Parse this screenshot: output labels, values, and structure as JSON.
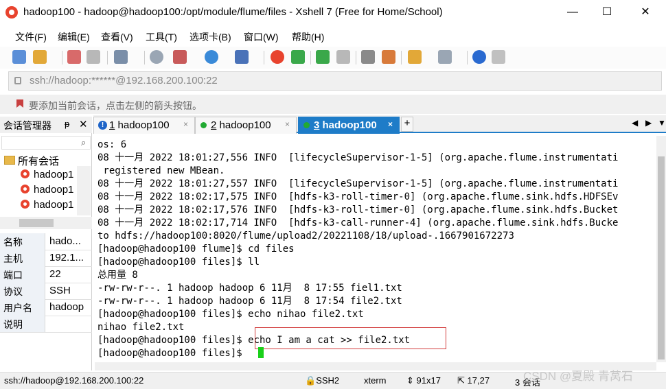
{
  "window": {
    "title": "hadoop100 - hadoop@hadoop100:/opt/module/flume/files - Xshell 7 (Free for Home/School)",
    "controls": {
      "minimize": "—",
      "maximize": "☐",
      "close": "✕"
    }
  },
  "menu": [
    "文件(F)",
    "编辑(E)",
    "查看(V)",
    "工具(T)",
    "选项卡(B)",
    "窗口(W)",
    "帮助(H)"
  ],
  "address": {
    "value": "ssh://hadoop:******@192.168.200.100:22"
  },
  "hint": {
    "text": "要添加当前会话，点击左侧的箭头按钮。"
  },
  "sidebar": {
    "title": "会话管理器",
    "pin": "ᵽ",
    "close": "✕",
    "search_icon": "⌕",
    "tree_root": "所有会话",
    "sessions": [
      "hadoop1",
      "hadoop1",
      "hadoop1"
    ],
    "properties": [
      {
        "key": "名称",
        "value": "hado..."
      },
      {
        "key": "主机",
        "value": "192.1..."
      },
      {
        "key": "端口",
        "value": "22"
      },
      {
        "key": "协议",
        "value": "SSH"
      },
      {
        "key": "用户名",
        "value": "hadoop"
      },
      {
        "key": "说明",
        "value": ""
      }
    ]
  },
  "tabs": [
    {
      "num": "1",
      "label": "hadoop100",
      "status": "warning"
    },
    {
      "num": "2",
      "label": "hadoop100",
      "status": "connected"
    },
    {
      "num": "3",
      "label": "hadoop100",
      "status": "connected"
    }
  ],
  "tab_close": "×",
  "tab_add": "+",
  "terminal": {
    "lines": [
      "os: 6",
      "08 十一月 2022 18:01:27,556 INFO  [lifecycleSupervisor-1-5] (org.apache.flume.instrumentati",
      " registered new MBean.",
      "08 十一月 2022 18:01:27,557 INFO  [lifecycleSupervisor-1-5] (org.apache.flume.instrumentati",
      "08 十一月 2022 18:02:17,575 INFO  [hdfs-k3-roll-timer-0] (org.apache.flume.sink.hdfs.HDFSEv",
      "08 十一月 2022 18:02:17,576 INFO  [hdfs-k3-roll-timer-0] (org.apache.flume.sink.hdfs.Bucket",
      "08 十一月 2022 18:02:17,714 INFO  [hdfs-k3-call-runner-4] (org.apache.flume.sink.hdfs.Bucke",
      "to hdfs://hadoop100:8020/flume/upload2/20221108/18/upload-.1667901672273",
      "[hadoop@hadoop100 flume]$ cd files",
      "[hadoop@hadoop100 files]$ ll",
      "总用量 8",
      "-rw-rw-r--. 1 hadoop hadoop 6 11月  8 17:55 fiel1.txt",
      "-rw-rw-r--. 1 hadoop hadoop 6 11月  8 17:54 file2.txt",
      "[hadoop@hadoop100 files]$ echo nihao file2.txt",
      "nihao file2.txt",
      "[hadoop@hadoop100 files]$ echo I am a cat >> file2.txt",
      "[hadoop@hadoop100 files]$ "
    ]
  },
  "status": {
    "connection": "ssh://hadoop@192.168.200.100:22",
    "protocol": "SSH2",
    "terminal_type": "xterm",
    "size": "91x17",
    "cursor_pos": "17,27",
    "sessions": "3 会话"
  },
  "watermark": "CSDN @夏殿 青莴石",
  "colors": {
    "accent": "#1e7cc8",
    "cursor": "#1ad01a",
    "highlight_border": "#d23a3a",
    "brand": "#e8432e"
  }
}
